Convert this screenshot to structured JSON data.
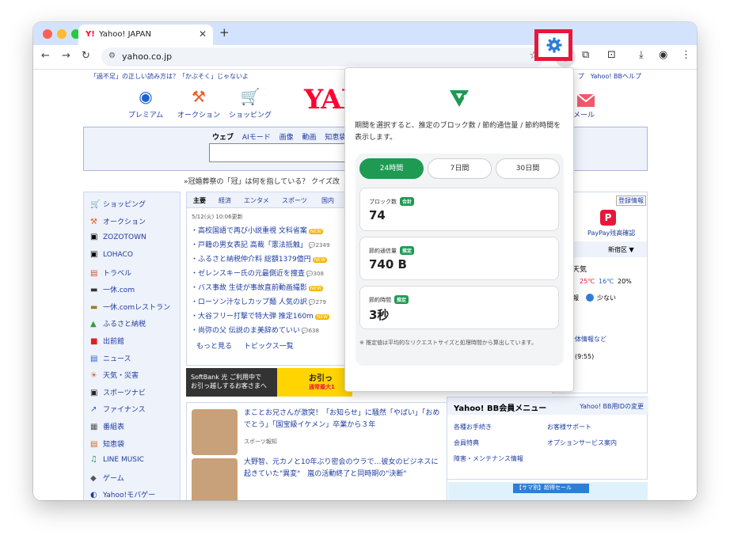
{
  "tab": {
    "title": "Yahoo! JAPAN",
    "favicon": "Y!"
  },
  "address": {
    "url": "yahoo.co.jp"
  },
  "page": {
    "notice": "「過不足」の正しい読み方は？「かぶそく」じゃないよ",
    "topright": "プ　Yahoo! BBヘルプ",
    "services": [
      "プレミアム",
      "オークション",
      "ショッピング"
    ],
    "logo": "YAH",
    "mail": "メール",
    "search_tabs": [
      "ウェブ",
      "AIモード",
      "画像",
      "動画",
      "知恵袋"
    ],
    "trend": "»冠婚葬祭の「冠」は何を指している？ クイズ改",
    "left_nav": [
      "ショッピング",
      "オークション",
      "ZOZOTOWN",
      "LOHACO",
      "トラベル",
      "一休.com",
      "一休.comレストラン",
      "ふるさと納税",
      "出前館",
      "ニュース",
      "天気・災害",
      "スポーツナビ",
      "ファイナンス",
      "番組表",
      "知恵袋",
      "LINE MUSIC",
      "ゲーム",
      "Yahoo!モバゲー"
    ],
    "news_tabs": [
      "主要",
      "経済",
      "エンタメ",
      "スポーツ",
      "国内"
    ],
    "news_date": "5/12(火) 10:06更新",
    "news_items": [
      {
        "text": "高校国語で再び小説重視 文科省案",
        "badge": "NEW",
        "count": ""
      },
      {
        "text": "戸籍の男女表記 高裁「憲法抵触」",
        "badge": "",
        "count": "2349"
      },
      {
        "text": "ふるさと納税仲介料 総額1379億円",
        "badge": "NEW",
        "count": ""
      },
      {
        "text": "ゼレンスキー氏の元最側近を捜査",
        "badge": "",
        "count": "308"
      },
      {
        "text": "バス事故 生徒が事故直前動画撮影",
        "badge": "NEW",
        "count": ""
      },
      {
        "text": "ローソン汁なしカップ麺 人気の訳",
        "badge": "",
        "count": "279"
      },
      {
        "text": "大谷フリー打撃で特大弾 推定160m",
        "badge": "NEW",
        "count": ""
      },
      {
        "text": "尚弥の父 伝説のま美辞めていい",
        "badge": "",
        "count": "638"
      }
    ],
    "news_more": "もっと見る",
    "news_topics": "トピックス一覧",
    "sb_banner_left": "SoftBank 光 ご利用中で",
    "sb_banner_left2": "お引っ越しするお客さまへ",
    "sb_banner_right": "お引っ",
    "sb_banner_right2": "通常最大1",
    "stories": [
      {
        "text": "まことお兄さんが激突！「お知らせ」に騒然「やばい」「おめでとう」「国宝級イケメン」卒業から３年",
        "src": "スポーツ報知"
      },
      {
        "text": "大野智、元カノと10年ぶり密会のウラで…彼女のビジネスに起きていた\"異変\"　嵐の活動終了と同時期の\"決断\"",
        "src": ""
      }
    ],
    "right": {
      "register": "登録情報",
      "paypay": "PayPay残高確認",
      "area": "新宿区 ▼",
      "weather": "天気",
      "temp_hi": "25℃",
      "temp_lo": "16℃",
      "rain": "20%",
      "pollen_label": "報",
      "pollen": "少ない",
      "local": "治体情報など",
      "time": "(9:55)"
    },
    "bb": {
      "title": "Yahoo! BB会員メニュー",
      "change": "Yahoo! BB用IDの変更",
      "links": [
        "各種お手続き",
        "お客様サポート",
        "会員特典",
        "オプションサービス案内",
        "障害・メンテナンス情報"
      ]
    },
    "ad": "【サマ割】超得セール"
  },
  "popup": {
    "description": "期間を選択すると、推定のブロック数 / 節約通信量 / 節約時間を表示します。",
    "periods": [
      "24時間",
      "7日間",
      "30日間"
    ],
    "active_period": "24時間",
    "stats": [
      {
        "label": "ブロック数",
        "badge": "合計",
        "value": "74"
      },
      {
        "label": "節約通信量",
        "badge": "推定",
        "value": "740 B"
      },
      {
        "label": "節約時間",
        "badge": "推定",
        "value": "3秒"
      }
    ],
    "note": "※ 推定値は平均的なリクエストサイズと処理時間から算出しています。",
    "accent": "#1e9a53"
  },
  "highlight_color": "#e8173a"
}
